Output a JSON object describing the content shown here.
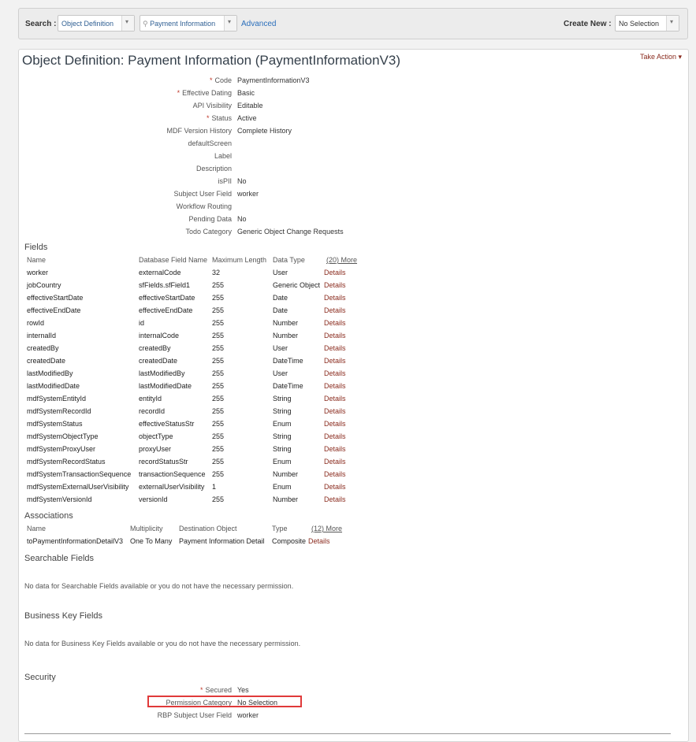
{
  "search": {
    "label": "Search :",
    "type_value": "Object Definition",
    "object_value": "Payment Information",
    "advanced": "Advanced",
    "create_label": "Create New :",
    "create_value": "No Selection"
  },
  "object": {
    "title": "Object Definition: Payment Information  (PaymentInformationV3)",
    "take_action": "Take Action ▾"
  },
  "properties": [
    {
      "label": "Code",
      "value": "PaymentInformationV3",
      "required": true
    },
    {
      "label": "Effective Dating",
      "value": "Basic",
      "required": true
    },
    {
      "label": "API Visibility",
      "value": "Editable",
      "required": false
    },
    {
      "label": "Status",
      "value": "Active",
      "required": true
    },
    {
      "label": "MDF Version History",
      "value": "Complete History",
      "required": false
    },
    {
      "label": "defaultScreen",
      "value": "",
      "required": false
    },
    {
      "label": "Label",
      "value": "",
      "required": false
    },
    {
      "label": "Description",
      "value": "",
      "required": false
    },
    {
      "label": "isPII",
      "value": "No",
      "required": false
    },
    {
      "label": "Subject User Field",
      "value": "worker",
      "required": false
    },
    {
      "label": "Workflow Routing",
      "value": "",
      "required": false
    },
    {
      "label": "Pending Data",
      "value": "No",
      "required": false
    },
    {
      "label": "Todo Category",
      "value": "Generic Object Change Requests",
      "required": false
    }
  ],
  "fields": {
    "title": "Fields",
    "headers": [
      "Name",
      "Database Field Name",
      "Maximum Length",
      "Data Type"
    ],
    "more": "(20) More",
    "details_label": "Details",
    "rows": [
      [
        "worker",
        "externalCode",
        "32",
        "User"
      ],
      [
        "jobCountry",
        "sfFields.sfField1",
        "255",
        "Generic Object"
      ],
      [
        "effectiveStartDate",
        "effectiveStartDate",
        "255",
        "Date"
      ],
      [
        "effectiveEndDate",
        "effectiveEndDate",
        "255",
        "Date"
      ],
      [
        "rowId",
        "id",
        "255",
        "Number"
      ],
      [
        "internalId",
        "internalCode",
        "255",
        "Number"
      ],
      [
        "createdBy",
        "createdBy",
        "255",
        "User"
      ],
      [
        "createdDate",
        "createdDate",
        "255",
        "DateTime"
      ],
      [
        "lastModifiedBy",
        "lastModifiedBy",
        "255",
        "User"
      ],
      [
        "lastModifiedDate",
        "lastModifiedDate",
        "255",
        "DateTime"
      ],
      [
        "mdfSystemEntityId",
        "entityId",
        "255",
        "String"
      ],
      [
        "mdfSystemRecordId",
        "recordId",
        "255",
        "String"
      ],
      [
        "mdfSystemStatus",
        "effectiveStatusStr",
        "255",
        "Enum"
      ],
      [
        "mdfSystemObjectType",
        "objectType",
        "255",
        "String"
      ],
      [
        "mdfSystemProxyUser",
        "proxyUser",
        "255",
        "String"
      ],
      [
        "mdfSystemRecordStatus",
        "recordStatusStr",
        "255",
        "Enum"
      ],
      [
        "mdfSystemTransactionSequence",
        "transactionSequence",
        "255",
        "Number"
      ],
      [
        "mdfSystemExternalUserVisibility",
        "externalUserVisibility",
        "1",
        "Enum"
      ],
      [
        "mdfSystemVersionId",
        "versionId",
        "255",
        "Number"
      ]
    ]
  },
  "associations": {
    "title": "Associations",
    "headers": [
      "Name",
      "Multiplicity",
      "Destination Object",
      "Type"
    ],
    "more": "(12) More",
    "details_label": "Details",
    "rows": [
      [
        "toPaymentInformationDetailV3",
        "One To Many",
        "Payment Information Detail",
        "Composite"
      ]
    ]
  },
  "searchable": {
    "title": "Searchable Fields",
    "message": "No data for Searchable Fields available or you do not have the necessary permission."
  },
  "business_key": {
    "title": "Business Key Fields",
    "message": "No data for Business Key Fields available or you do not have the necessary permission."
  },
  "security": {
    "title": "Security",
    "rows": [
      {
        "label": "Secured",
        "value": "Yes",
        "required": true
      },
      {
        "label": "Permission Category",
        "value": "No Selection",
        "required": false
      },
      {
        "label": "RBP Subject User Field",
        "value": "worker",
        "required": false
      }
    ]
  },
  "colors": {
    "link": "#2a6ebb",
    "details": "#8a2b1e",
    "required": "#c0392b",
    "highlight": "#e03a3a"
  }
}
